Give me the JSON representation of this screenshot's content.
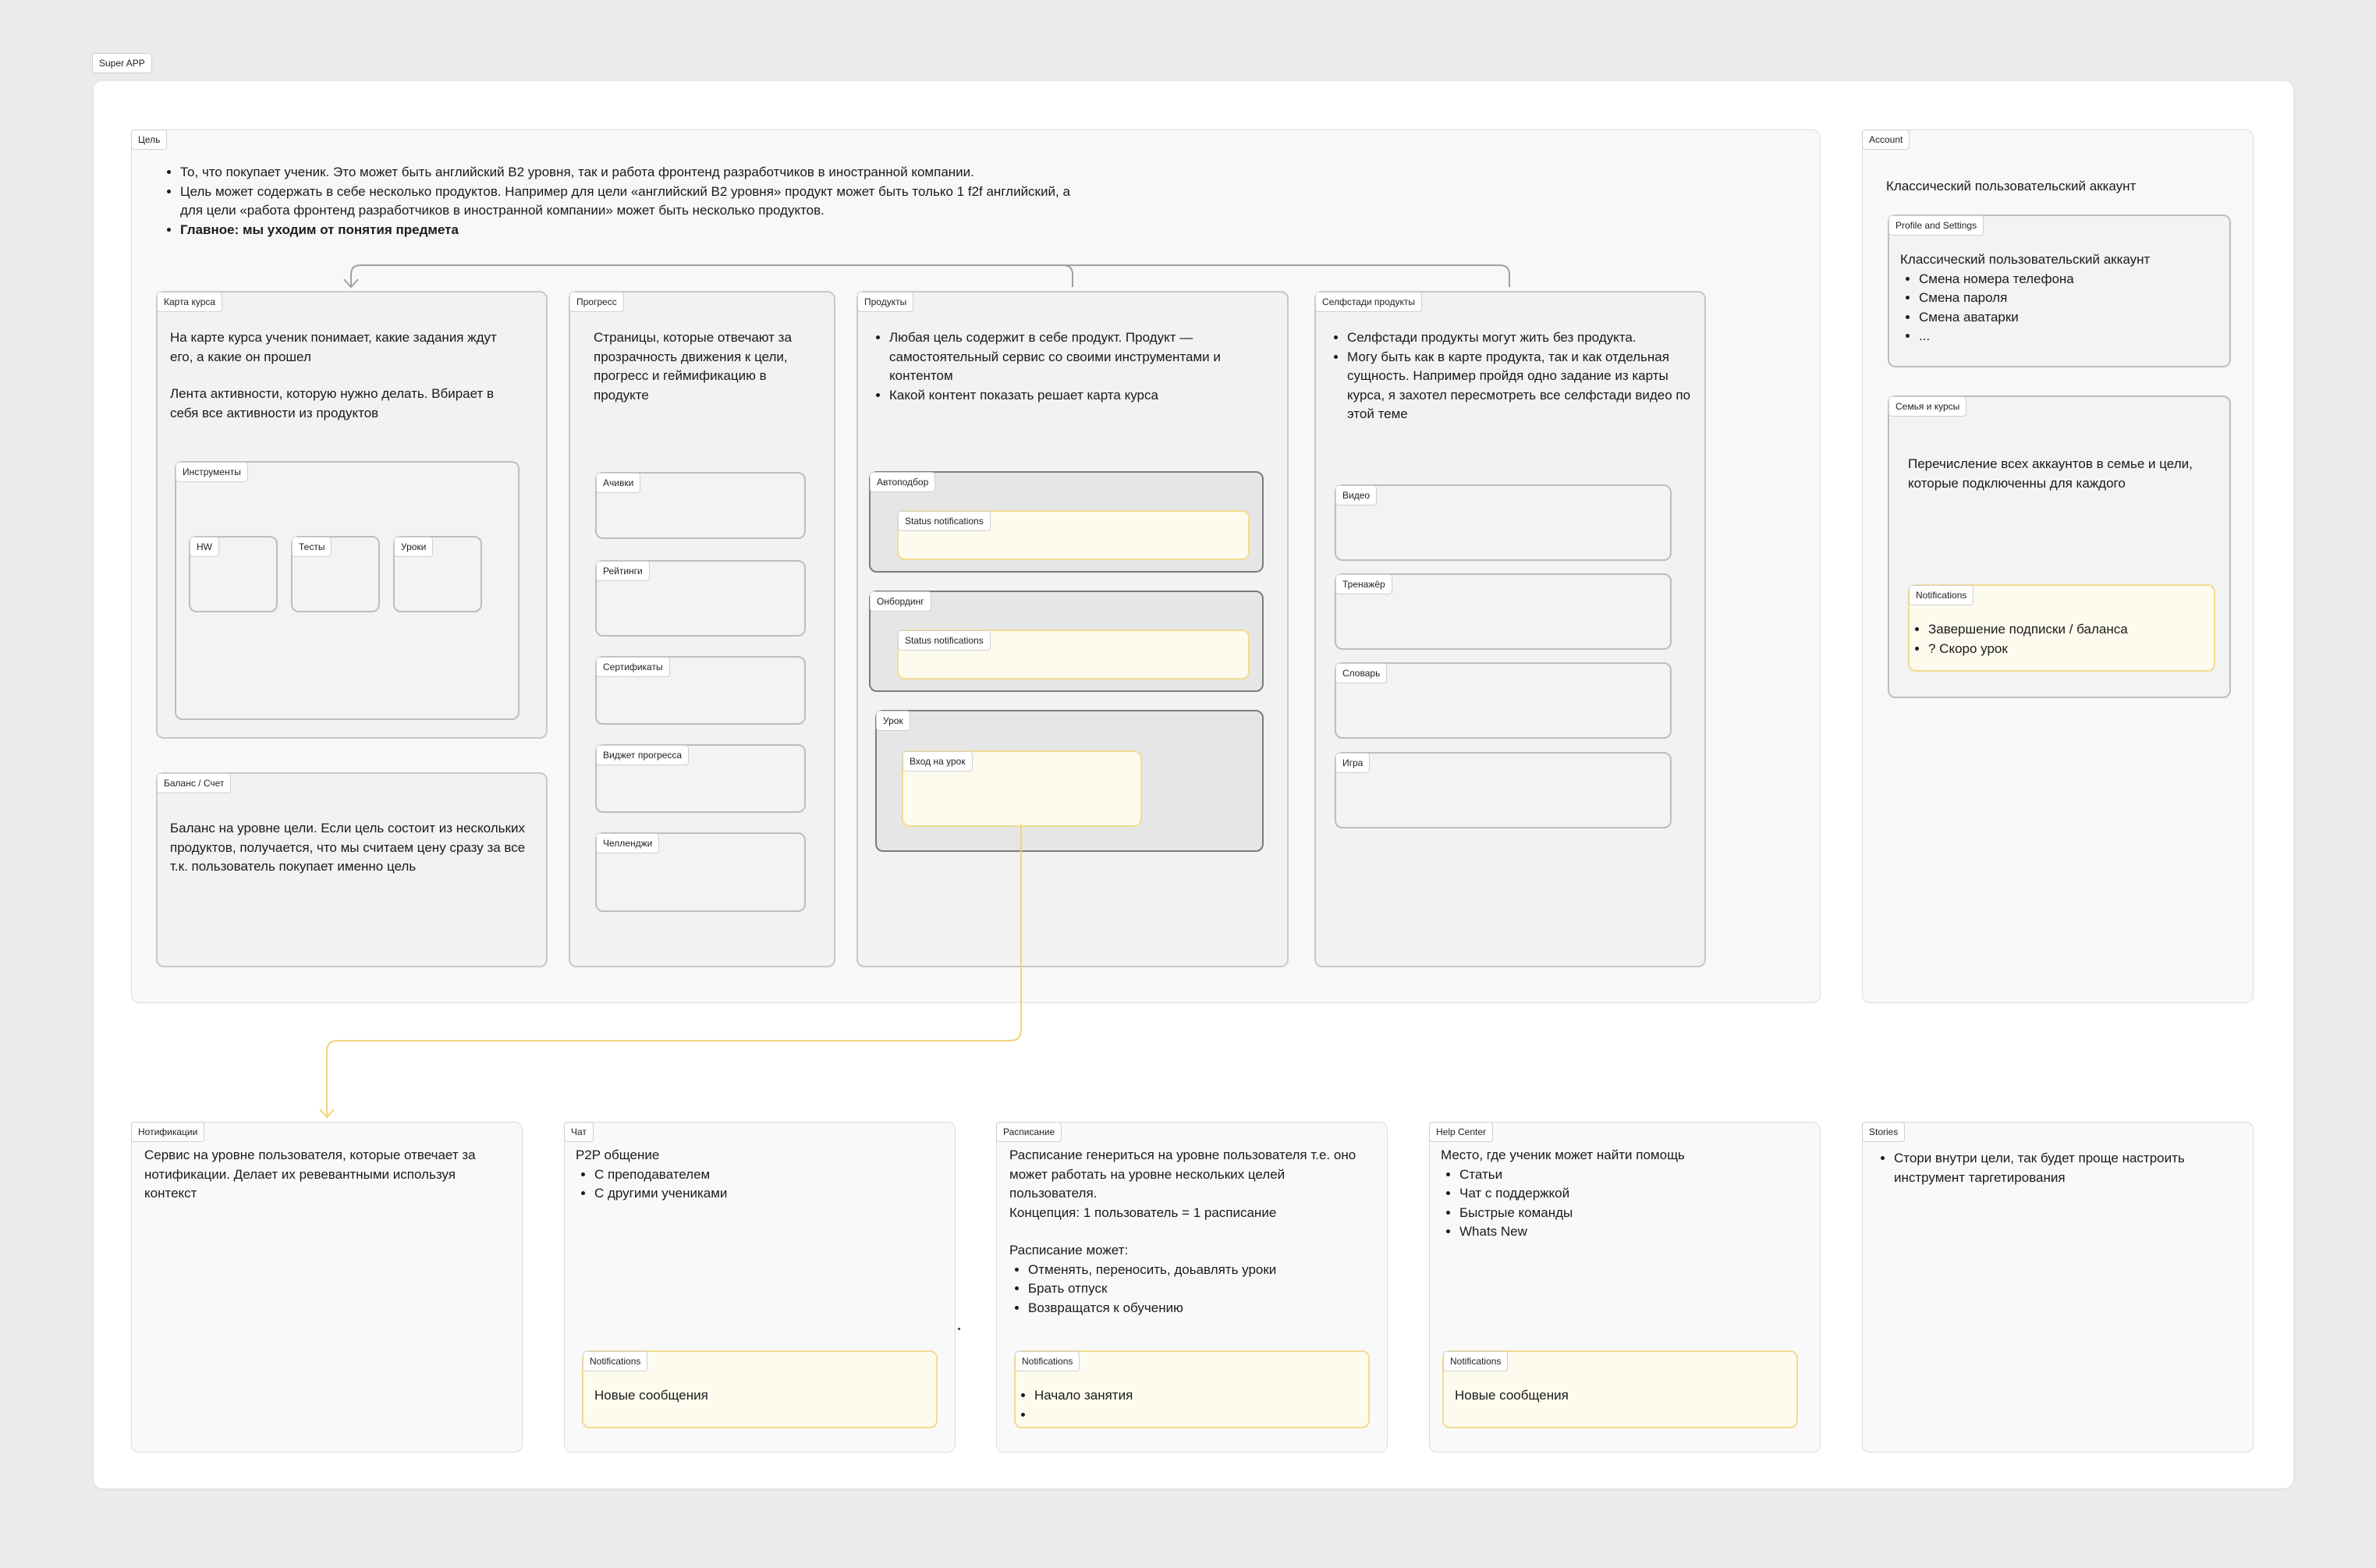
{
  "board": {
    "title": "Super APP"
  },
  "goal": {
    "tag": "Цель",
    "bullets": [
      "То, что покупает ученик. Это может быть английский B2 уровня, так и работа фронтенд разработчиков в иностранной компании.",
      "Цель может содержать в себе несколько продуктов. Например для цели «английский B2 уровня» продукт может быть только 1 f2f английский, а для цели «работа фронтенд разработчиков в иностранной компании» может быть несколько продуктов.",
      "Главное: мы уходим от понятия предмета"
    ],
    "course_map": {
      "tag": "Карта курса",
      "text1": "На карте курса ученик понимает, какие задания ждут его, а какие он прошел",
      "text2": "Лента активности, которую нужно делать. Вбирает в себя все активности из продуктов",
      "tools": {
        "tag": "Инструменты",
        "items": [
          "HW",
          "Тесты",
          "Уроки"
        ]
      }
    },
    "balance": {
      "tag": "Баланс / Счет",
      "text": "Баланс на уровне цели. Если цель состоит из нескольких продуктов, получается, что мы считаем цену сразу за все т.к. пользователь покупает именно цель"
    },
    "progress": {
      "tag": "Прогресс",
      "text": "Страницы, которые отвечают за прозрачность движения к цели, прогресс и геймификацию в продукте",
      "items": [
        "Ачивки",
        "Рейтинги",
        "Сертификаты",
        "Виджет прогресса",
        "Челленджи"
      ]
    },
    "products": {
      "tag": "Продукты",
      "bullets": [
        "Любая цель содержит в себе продукт. Продукт — самостоятельный сервис со своими инструментами и контентом",
        "Какой контент показать решает карта курса"
      ],
      "autopick": {
        "tag": "Автоподбор",
        "note": "Status notifications"
      },
      "onboarding": {
        "tag": "Онбординг",
        "note": "Status notifications"
      },
      "lesson": {
        "tag": "Урок",
        "note": "Вход на урок"
      }
    },
    "selfstudy": {
      "tag": "Селфстади продукты",
      "bullets": [
        "Селфстади продукты могут жить без продукта.",
        "Могу быть как в карте продукта, так и как отдельная сущность. Например пройдя одно задание из карты курса, я захотел пересмотреть все селфстади видео по этой теме"
      ],
      "items": [
        "Видео",
        "Тренажёр",
        "Словарь",
        "Игра"
      ]
    }
  },
  "account": {
    "tag": "Account",
    "title": "Классический пользовательский аккаунт",
    "profile": {
      "tag": "Profile and Settings",
      "title": "Классический пользовательский аккаунт",
      "items": [
        "Смена номера телефона",
        "Смена пароля",
        "Смена аватарки",
        "..."
      ]
    },
    "family": {
      "tag": "Семья и курсы",
      "text": "Перечисление всех аккаунтов в семье и цели, которые подключенны для каждого",
      "notifications": {
        "tag": "Notifications",
        "items": [
          "Завершение подписки / баланса",
          "? Скоро урок"
        ]
      }
    }
  },
  "bottom": {
    "notify": {
      "tag": "Нотификации",
      "text": "Сервис на уровне пользователя, которые отвечает за нотификации. Делает их ревевантными используя контекст"
    },
    "chat": {
      "tag": "Чат",
      "title": "P2P общение",
      "items": [
        "С преподавателем",
        "С другими учениками"
      ],
      "notifications": {
        "tag": "Notifications",
        "text": "Новые сообщения"
      }
    },
    "schedule": {
      "tag": "Расписание",
      "text1": "Расписание генериться на уровне пользователя т.е. оно может работать на уровне нескольких целей пользователя.",
      "text2": "Концепция: 1 пользователь = 1 расписание",
      "text3": "Расписание может:",
      "items": [
        "Отменять, переносить, доьавлять уроки",
        "Брать отпуск",
        "Возвращатся к обучению"
      ],
      "notifications": {
        "tag": "Notifications",
        "items": [
          "Начало занятия",
          ""
        ]
      }
    },
    "help": {
      "tag": "Help Center",
      "title": "Место, где ученик может найти помощь",
      "items": [
        "Статьи",
        "Чат с поддержкой",
        "Быстрые команды",
        "Whats New"
      ],
      "notifications": {
        "tag": "Notifications",
        "text": "Новые сообщения"
      }
    },
    "stories": {
      "tag": "Stories",
      "items": [
        "Стори внутри цели, так будет проще настроить инструмент таргетирования"
      ]
    }
  },
  "colors": {
    "notify_fill": "#fdfbee",
    "notify_border": "#f3dc8f",
    "arrow": "#f3d27a"
  }
}
